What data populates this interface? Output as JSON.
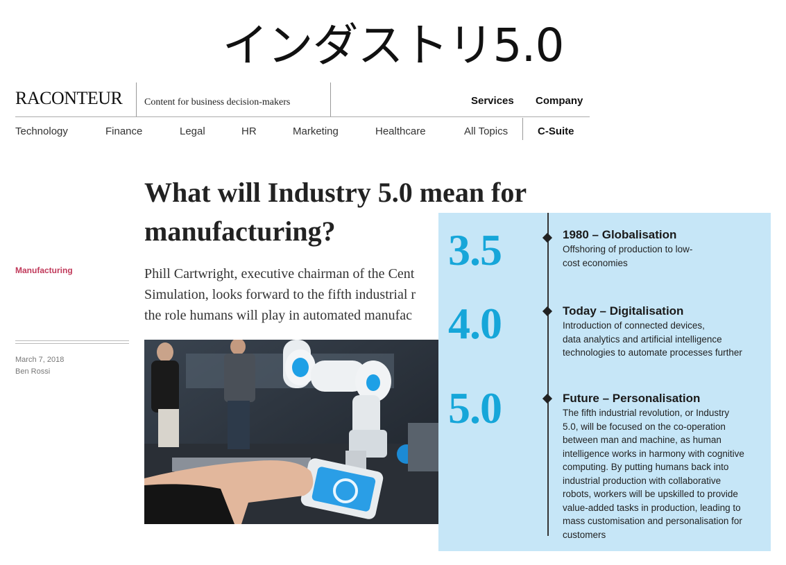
{
  "slide": {
    "title": "インダストリ5.0"
  },
  "header": {
    "logo": "RACONTEUR",
    "tagline": "Content for business decision-makers",
    "links": [
      "Services",
      "Company"
    ]
  },
  "nav": {
    "items": [
      "Technology",
      "Finance",
      "Legal",
      "HR",
      "Marketing",
      "Healthcare",
      "All Topics",
      "C-Suite"
    ]
  },
  "sidebar": {
    "category": "Manufacturing",
    "date": "March 7, 2018",
    "author": "Ben Rossi"
  },
  "article": {
    "headline_line1": "What will Industry 5.0 mean for",
    "headline_line2": "manufacturing?",
    "standfirst_lines": [
      "Phill Cartwright, executive chairman of the Cent",
      "Simulation, looks forward to the fifth industrial r",
      "the role humans will play in automated manufac"
    ]
  },
  "infographic": {
    "events": [
      {
        "number": "3.5",
        "title": "1980 – Globalisation",
        "lines": [
          "Offshoring of production to low-",
          "cost economies"
        ]
      },
      {
        "number": "4.0",
        "title": "Today – Digitalisation",
        "lines": [
          "Introduction of connected devices,",
          "data analytics and artificial intelligence",
          "technologies to automate processes further"
        ]
      },
      {
        "number": "5.0",
        "title": "Future – Personalisation",
        "lines": [
          "The fifth industrial revolution, or Industry",
          "5.0, will be focused on the co-operation",
          "between man and machine, as human",
          "intelligence works in harmony with cognitive",
          "computing. By putting humans back into",
          "industrial production with collaborative",
          "robots, workers will be upskilled to provide",
          "value-added tasks in production, leading to",
          "mass customisation and personalisation for",
          "customers"
        ]
      }
    ]
  },
  "colors": {
    "accent_blue": "#16a6d9",
    "panel_bg": "#c6e6f7",
    "category_red": "#c0395a"
  }
}
